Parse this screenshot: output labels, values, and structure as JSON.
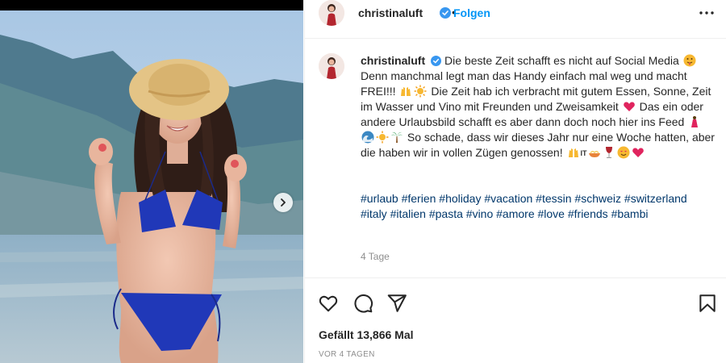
{
  "post": {
    "username": "christinaluft",
    "follow_label": "Folgen",
    "separator": "•",
    "caption": {
      "part1": "Die beste Zeit schafft es nicht auf Social Media",
      "part2": "Denn manchmal legt man das Handy einfach mal weg und macht FREI!!!",
      "part3": "Die Zeit hab ich verbracht mit gutem Essen, Sonne, Zeit im Wasser und Vino mit Freunden und Zweisamkeit",
      "part4": "Das ein oder andere Urlaubsbild schafft es aber dann doch noch hier ins Feed",
      "part5": "So schade, dass wir dieses Jahr nur eine Woche hatten, aber die haben wir in vollen Zügen genossen!",
      "it_label": "IT"
    },
    "hashtags": [
      "#urlaub",
      "#ferien",
      "#holiday",
      "#vacation",
      "#tessin",
      "#schweiz",
      "#switzerland",
      "#italy",
      "#italien",
      "#pasta",
      "#vino",
      "#amore",
      "#love",
      "#friends",
      "#bambi"
    ],
    "time_ago": "4 Tage",
    "likes": "Gefällt 13,866 Mal",
    "date": "VOR 4 TAGEN"
  },
  "icons": {
    "verified": "verified-badge-icon",
    "more": "more-options-icon",
    "next": "chevron-right-icon",
    "like": "heart-icon",
    "comment": "comment-icon",
    "share": "paper-plane-icon",
    "save": "bookmark-icon"
  },
  "colors": {
    "accent": "#0095f6",
    "hashtag": "#00376b",
    "muted": "#8e8e8e",
    "text": "#262626"
  }
}
